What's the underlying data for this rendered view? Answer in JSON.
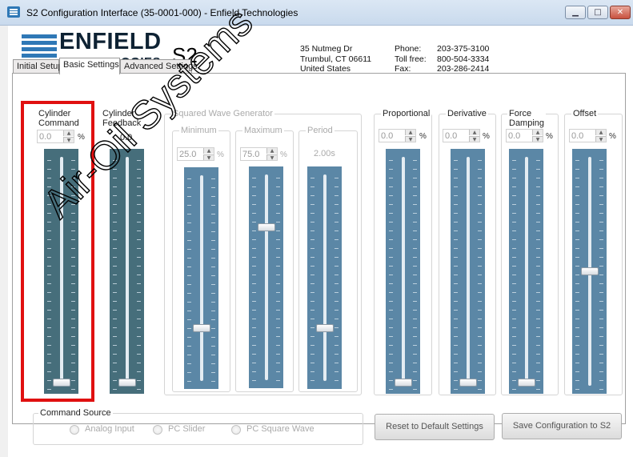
{
  "window": {
    "title": "S2 Configuration Interface (35-0001-000) - Enfield Technologies",
    "minimize": "▁",
    "maximize": "□",
    "close": "✕"
  },
  "header": {
    "brand_name": "ENFIELD",
    "brand_sub": "TECHNOLOGIES",
    "model": "S2",
    "address": [
      "35 Nutmeg Dr",
      "Trumbul, CT 06611",
      "United States"
    ],
    "contacts": [
      {
        "label": "Phone:",
        "value": "203-375-3100"
      },
      {
        "label": "Toll free:",
        "value": "800-504-3334"
      },
      {
        "label": "Fax:",
        "value": "203-286-2414"
      }
    ]
  },
  "tabs": [
    "Initial Setup",
    "Basic Settings",
    "Advanced Settings"
  ],
  "active_tab": "Basic Settings",
  "columns": {
    "cyl_cmd": {
      "label": [
        "Cylinder",
        "Command"
      ],
      "value": "0.0",
      "unit": "%",
      "slider_fraction": 0.0
    },
    "cyl_fb": {
      "label": [
        "Cylinder",
        "Feedback"
      ],
      "value": "0.0",
      "slider_fraction": 0.0
    },
    "sq_group": "Squared Wave Generator",
    "minimum": {
      "label": "Minimum",
      "value": "25.0",
      "unit": "%",
      "slider_fraction": 0.25
    },
    "maximum": {
      "label": "Maximum",
      "value": "75.0",
      "unit": "%",
      "slider_fraction": 0.75
    },
    "period": {
      "label": "Period",
      "value": "2.00s",
      "slider_fraction": 0.25
    },
    "proportional": {
      "label": "Proportional",
      "value": "0.0",
      "unit": "%",
      "slider_fraction": 0.0
    },
    "derivative": {
      "label": "Derivative",
      "value": "0.0",
      "unit": "%",
      "slider_fraction": 0.0
    },
    "force_damping": {
      "label": [
        "Force",
        "Damping"
      ],
      "value": "0.0",
      "unit": "%",
      "slider_fraction": 0.0
    },
    "offset": {
      "label": "Offset",
      "value": "0.0",
      "unit": "%",
      "slider_fraction": 0.5
    }
  },
  "command_source": {
    "title": "Command Source",
    "options": [
      "Analog Input",
      "PC Slider",
      "PC Square Wave"
    ]
  },
  "buttons": {
    "reset": "Reset to Default Settings",
    "save": "Save Configuration to S2"
  },
  "watermark": "Air-Oil Systems",
  "colors": {
    "slider": "#5b87a6",
    "slider_dark": "#466e7b",
    "highlight": "#e01010",
    "logo": "#2f78b6"
  }
}
